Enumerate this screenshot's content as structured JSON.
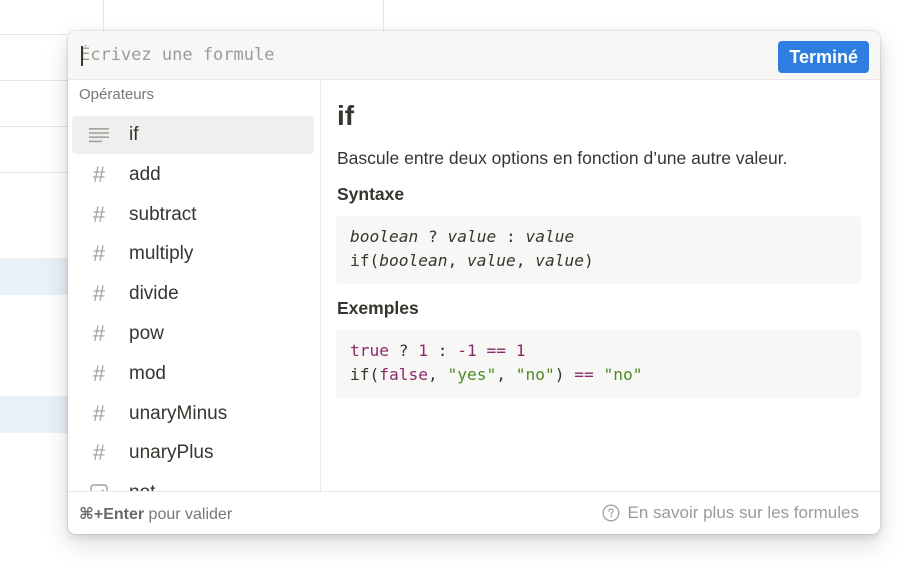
{
  "formula_bar": {
    "placeholder": "Écrivez une formule",
    "done_label": "Terminé"
  },
  "operators": {
    "section_label": "Opérateurs",
    "items": [
      {
        "label": "if",
        "icon": "text-lines-icon",
        "selected": true
      },
      {
        "label": "add",
        "icon": "hash-icon"
      },
      {
        "label": "subtract",
        "icon": "hash-icon"
      },
      {
        "label": "multiply",
        "icon": "hash-icon"
      },
      {
        "label": "divide",
        "icon": "hash-icon"
      },
      {
        "label": "pow",
        "icon": "hash-icon"
      },
      {
        "label": "mod",
        "icon": "hash-icon"
      },
      {
        "label": "unaryMinus",
        "icon": "hash-icon"
      },
      {
        "label": "unaryPlus",
        "icon": "hash-icon"
      },
      {
        "label": "not",
        "icon": "checkbox-icon"
      }
    ]
  },
  "doc": {
    "title": "if",
    "description": "Bascule entre deux options en fonction d’une autre valeur.",
    "syntax_heading": "Syntaxe",
    "syntax_lines": [
      [
        {
          "t": "boolean",
          "c": "it"
        },
        {
          "t": " ? ",
          "c": ""
        },
        {
          "t": "value",
          "c": "it"
        },
        {
          "t": " : ",
          "c": ""
        },
        {
          "t": "value",
          "c": "it"
        }
      ],
      [
        {
          "t": "if(",
          "c": ""
        },
        {
          "t": "boolean",
          "c": "it"
        },
        {
          "t": ", ",
          "c": ""
        },
        {
          "t": "value",
          "c": "it"
        },
        {
          "t": ", ",
          "c": ""
        },
        {
          "t": "value",
          "c": "it"
        },
        {
          "t": ")",
          "c": ""
        }
      ]
    ],
    "examples_heading": "Exemples",
    "example_lines": [
      [
        {
          "t": "true",
          "c": "kw"
        },
        {
          "t": " ? ",
          "c": ""
        },
        {
          "t": "1",
          "c": "num"
        },
        {
          "t": " : ",
          "c": ""
        },
        {
          "t": "-1",
          "c": "num"
        },
        {
          "t": " ",
          "c": ""
        },
        {
          "t": "==",
          "c": "op"
        },
        {
          "t": " ",
          "c": ""
        },
        {
          "t": "1",
          "c": "num"
        }
      ],
      [
        {
          "t": "if(",
          "c": ""
        },
        {
          "t": "false",
          "c": "kw"
        },
        {
          "t": ", ",
          "c": ""
        },
        {
          "t": "\"yes\"",
          "c": "str"
        },
        {
          "t": ", ",
          "c": ""
        },
        {
          "t": "\"no\"",
          "c": "str"
        },
        {
          "t": ") ",
          "c": ""
        },
        {
          "t": "==",
          "c": "op"
        },
        {
          "t": " ",
          "c": ""
        },
        {
          "t": "\"no\"",
          "c": "str"
        }
      ]
    ]
  },
  "footer": {
    "shortcut_key": "⌘+Enter",
    "shortcut_text": " pour valider",
    "learn_more_label": "En savoir plus sur les formules"
  },
  "colors": {
    "accent": "#2f7de1",
    "selected_row": "#efefed",
    "keyword": "#8c2a6c",
    "string": "#4e8a22"
  }
}
